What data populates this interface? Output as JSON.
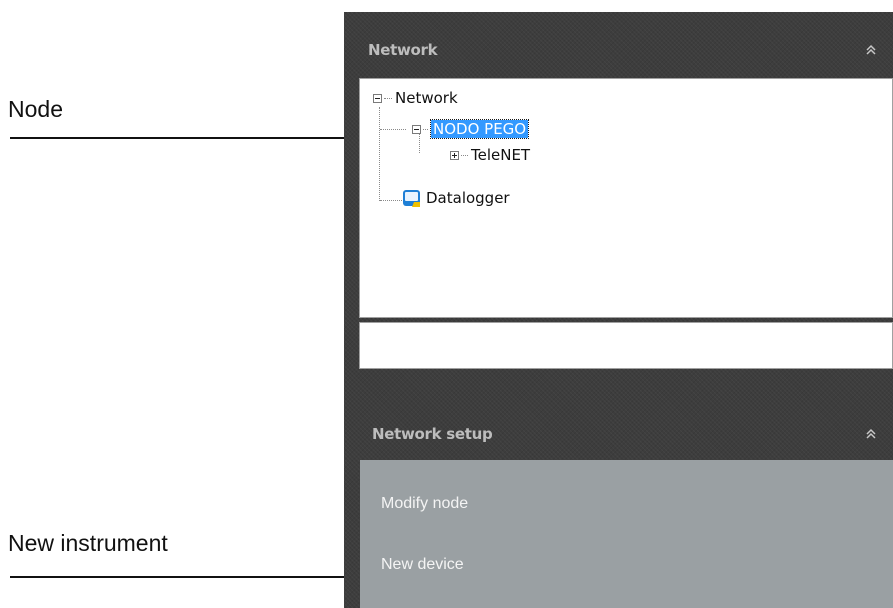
{
  "annotations": {
    "node_label": "Node",
    "new_instrument_label": "New instrument"
  },
  "network_panel": {
    "title": "Network",
    "collapse_icon": "double-chevron-up-icon",
    "tree": {
      "root": "Network",
      "node": "NODO PEGO",
      "child": "TeleNET",
      "datalogger": "Datalogger",
      "selected": "NODO PEGO"
    },
    "status_text": ""
  },
  "network_setup": {
    "title": "Network setup",
    "collapse_icon": "double-chevron-up-icon",
    "items": [
      {
        "label": "Modify node"
      },
      {
        "label": "New device"
      }
    ]
  },
  "colors": {
    "panel_bg": "#3d3d3d",
    "header_text": "#bdbdbd",
    "selection": "#3399ff",
    "setup_bg": "#9aa0a3",
    "datalogger_icon": "#1e7fd6"
  }
}
